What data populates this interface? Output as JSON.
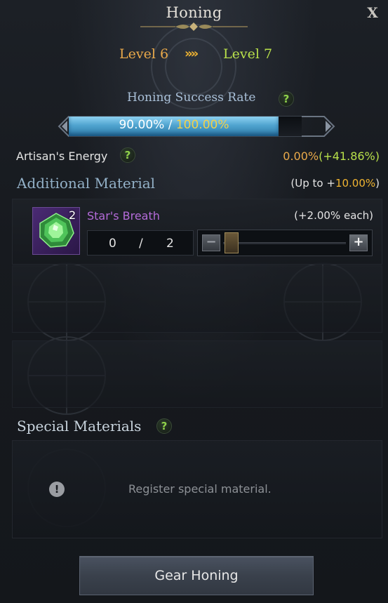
{
  "window": {
    "title": "Honing",
    "close_label": "X"
  },
  "levels": {
    "from": "Level 6",
    "arrows": "»»",
    "to": "Level 7"
  },
  "success_rate": {
    "label": "Honing Success Rate",
    "help": "?",
    "current": "90.00%",
    "separator": " / ",
    "max": "100.00%",
    "fill_fraction": 0.9
  },
  "artisan": {
    "label": "Artisan's Energy",
    "help": "?",
    "current": "0.00%",
    "bonus": "(+41.86%)"
  },
  "additional_material": {
    "title": "Additional Material",
    "up_to_prefix": "(Up to +",
    "up_to_value": "10.00%",
    "up_to_suffix": ")",
    "item": {
      "name": "Star's Breath",
      "count": "2",
      "each": "(+2.00% each)",
      "qty_current": "0",
      "qty_slash": "/",
      "qty_max": "2",
      "minus_label": "−",
      "plus_label": "+",
      "icon": "green-gem-icon",
      "rarity_color": "#b46bd9"
    }
  },
  "special_materials": {
    "title": "Special Materials",
    "help": "?",
    "alert": "!",
    "hint": "Register special material."
  },
  "action": {
    "button_label": "Gear Honing"
  },
  "colors": {
    "level_from": "#e9a94a",
    "level_to": "#b8e04a",
    "bar_fill": "#4fa3cf",
    "accent_gold": "#f0b431"
  }
}
